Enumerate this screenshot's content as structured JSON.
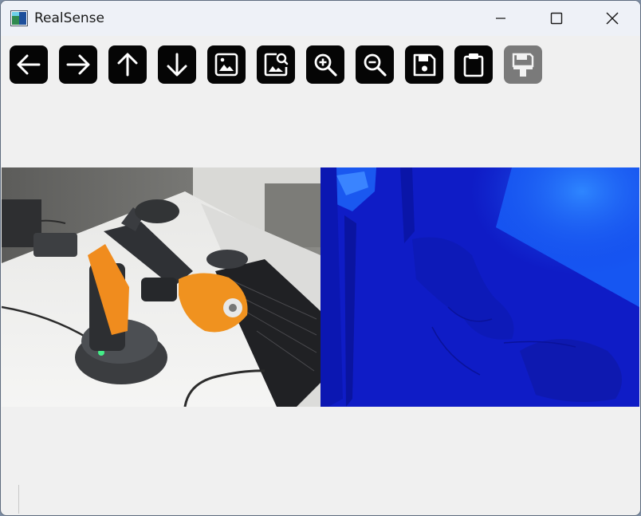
{
  "window": {
    "title": "RealSense",
    "controls": [
      "minimize",
      "maximize",
      "close"
    ]
  },
  "toolbar": {
    "buttons": [
      {
        "id": "prev",
        "icon": "arrow-left-icon",
        "enabled": true
      },
      {
        "id": "next",
        "icon": "arrow-right-icon",
        "enabled": true
      },
      {
        "id": "up",
        "icon": "arrow-up-icon",
        "enabled": true
      },
      {
        "id": "down",
        "icon": "arrow-down-icon",
        "enabled": true
      },
      {
        "id": "image",
        "icon": "image-icon",
        "enabled": true
      },
      {
        "id": "image-search",
        "icon": "image-search-icon",
        "enabled": true
      },
      {
        "id": "zoom-in",
        "icon": "zoom-in-icon",
        "enabled": true
      },
      {
        "id": "zoom-out",
        "icon": "zoom-out-icon",
        "enabled": true
      },
      {
        "id": "save",
        "icon": "save-icon",
        "enabled": true
      },
      {
        "id": "clipboard",
        "icon": "clipboard-icon",
        "enabled": true
      },
      {
        "id": "save-as",
        "icon": "save-brush-icon",
        "enabled": false
      }
    ]
  },
  "panes": {
    "color": {
      "content": "color-camera-frame"
    },
    "depth": {
      "content": "depth-camera-frame",
      "colormap": "blue"
    }
  },
  "colors": {
    "titlebar": "#eef1f7",
    "window_bg": "#f0f0f0",
    "toolbar_button": "#050505",
    "toolbar_button_disabled": "#7a7a7a",
    "depth_near": "#0f1fc4",
    "depth_far": "#1a6cff"
  }
}
